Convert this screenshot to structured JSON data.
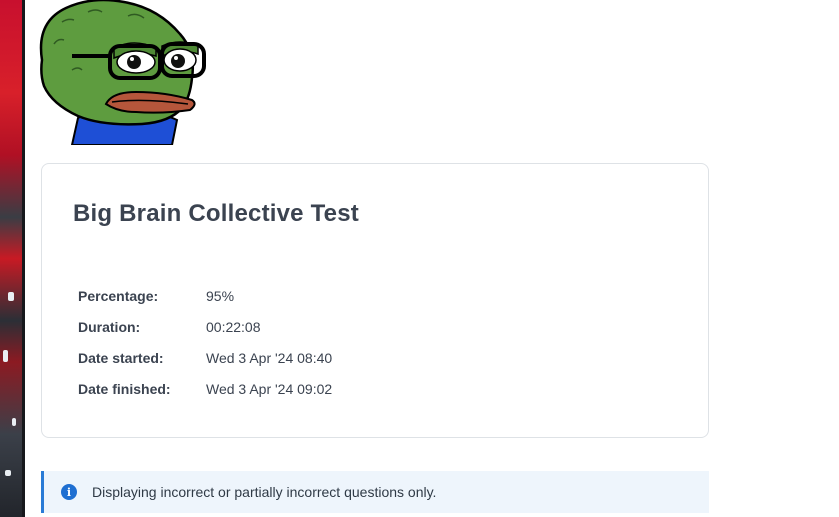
{
  "avatar": {
    "icon": "frog-with-glasses-avatar"
  },
  "quiz": {
    "title": "Big Brain Collective Test",
    "summary": [
      {
        "label": "Percentage:",
        "value": "95%"
      },
      {
        "label": "Duration:",
        "value": "00:22:08"
      },
      {
        "label": "Date started:",
        "value": "Wed 3 Apr '24 08:40"
      },
      {
        "label": "Date finished:",
        "value": "Wed 3 Apr '24 09:02"
      }
    ]
  },
  "notice": {
    "icon": "info-icon",
    "text": "Displaying incorrect or partially incorrect questions only."
  },
  "colors": {
    "notice_border": "#2a7bd6",
    "notice_bg": "#eef5fc",
    "title": "#3b4350"
  }
}
